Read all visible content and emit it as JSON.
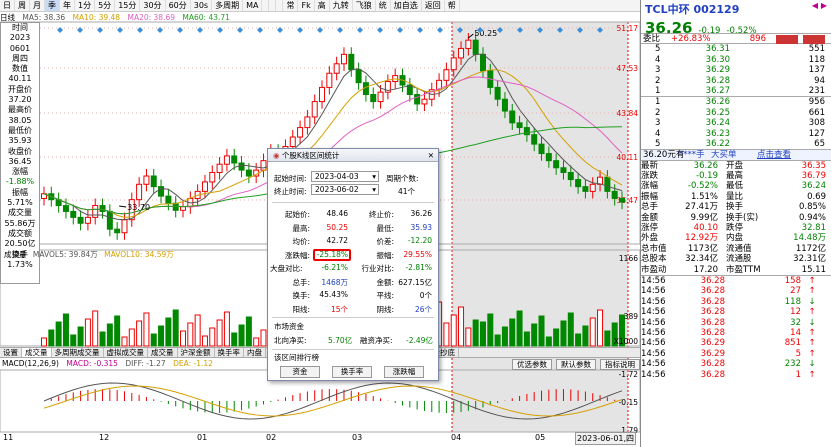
{
  "toolbar": {
    "items": [
      "日",
      "周",
      "月",
      "季",
      "年",
      "1分",
      "5分",
      "15分",
      "30分",
      "60分",
      "30s",
      "多周期",
      "MA",
      "",
      "",
      "",
      "常",
      "Fk",
      "高",
      "九转",
      "飞狼",
      "统",
      "加自选",
      "返回",
      "帮"
    ],
    "active": 3
  },
  "legend": {
    "name": "日线",
    "ma5": "MA5: 38.36",
    "ma10": "MA10: 39.48",
    "ma20": "MA20: 38.69",
    "ma60": "MA60: 43.71",
    "colors": {
      "ma5": "#555555",
      "ma10": "#d4a000",
      "ma20": "#e060c0",
      "ma60": "#20a020"
    }
  },
  "side_panel": [
    "时间",
    "2023",
    "0601",
    "周四",
    "数值",
    "40.11",
    "开盘价",
    "37.20",
    "最高价",
    "38.05",
    "最低价",
    "35.93",
    "收盘价",
    "36.45",
    "涨幅",
    "-1.88%",
    "振幅",
    "5.71%",
    "成交量",
    "55.86万",
    "成交额",
    "20.50亿",
    "换手",
    "1.73%"
  ],
  "price_axis": [
    "51.17",
    "47.53",
    "43.84",
    "40.11",
    "36.47"
  ],
  "chart_labels": {
    "high": "50.25",
    "low": "33.70"
  },
  "volume": {
    "legend": [
      "成交量",
      "MAVOL5: 39.84万",
      "MAVOL10: 34.59万"
    ],
    "axis": [
      "1166",
      "389",
      "X1000"
    ]
  },
  "bottom_tabs": [
    "设置",
    "成交量",
    "多周期成交量",
    "虚拟成交量",
    "成交量",
    "沪深金额",
    "换手率",
    "内盘",
    "胀跌通持续变化",
    "融资融券变化",
    "机构探测器",
    "资金抄底"
  ],
  "macd": {
    "legend": [
      "MACD(12,26,9)",
      "MACD: -0.315",
      "DIFF: -1.27",
      "DEA: -1.12"
    ],
    "axis": [
      "-1.72",
      "-0.15",
      "1.79"
    ],
    "subtabs": [
      "优选参数",
      "默认参数",
      "指标说明"
    ]
  },
  "x_axis": {
    "labels": [
      "11",
      "12",
      "01",
      "02",
      "03",
      "04",
      "05"
    ],
    "date": "2023-06-01,四"
  },
  "quote": {
    "name": "TCL中环",
    "code": "002129",
    "price": "36.26",
    "change": "-0.19",
    "pct": "-0.52%",
    "ratio_label": "委比",
    "ratio": "+26.83%",
    "diff": "896",
    "sell": "卖",
    "buy": "买",
    "asks": [
      [
        "5",
        "36.31",
        "551"
      ],
      [
        "4",
        "36.30",
        "118"
      ],
      [
        "3",
        "36.29",
        "137"
      ],
      [
        "2",
        "36.28",
        "94"
      ],
      [
        "1",
        "36.27",
        "231"
      ]
    ],
    "bids": [
      [
        "1",
        "36.26",
        "956"
      ],
      [
        "2",
        "36.25",
        "661"
      ],
      [
        "3",
        "36.24",
        "308"
      ],
      [
        "4",
        "36.23",
        "127"
      ],
      [
        "5",
        "36.22",
        "65"
      ]
    ],
    "banner": [
      "36.20元有",
      "****手",
      "大买单",
      "点击查看"
    ],
    "stats": [
      [
        "最新",
        "36.26",
        "开盘",
        "36.35"
      ],
      [
        "涨跌",
        "-0.19",
        "最高",
        "36.79"
      ],
      [
        "涨幅",
        "-0.52%",
        "最低",
        "36.24"
      ],
      [
        "振幅",
        "1.51%",
        "量比",
        "0.69"
      ],
      [
        "总手",
        "27.41万",
        "换手",
        "0.85%"
      ],
      [
        "金额",
        "9.99亿",
        "换手(实)",
        "0.94%"
      ],
      [
        "涨停",
        "40.10",
        "跌停",
        "32.81"
      ],
      [
        "外盘",
        "12.92万",
        "内盘",
        "14.48万"
      ],
      [
        "总市值",
        "1173亿",
        "流通值",
        "1172亿"
      ],
      [
        "总股本",
        "32.34亿",
        "流通股",
        "32.31亿"
      ],
      [
        "市盈动",
        "17.20",
        "市盈TTM",
        "15.11"
      ]
    ],
    "ticks": [
      [
        "14:56",
        "36.28",
        "158",
        "↑"
      ],
      [
        "14:56",
        "36.28",
        "27",
        "↑"
      ],
      [
        "14:56",
        "36.28",
        "118",
        "↓"
      ],
      [
        "14:56",
        "36.28",
        "12",
        "↑"
      ],
      [
        "14:56",
        "36.28",
        "32",
        "↓"
      ],
      [
        "14:56",
        "36.28",
        "14",
        "↑"
      ],
      [
        "14:56",
        "36.29",
        "851",
        "↑"
      ],
      [
        "14:56",
        "36.29",
        "5",
        "↑"
      ],
      [
        "14:56",
        "36.28",
        "232",
        "↓"
      ],
      [
        "14:56",
        "36.28",
        "1",
        "↑"
      ]
    ]
  },
  "dialog": {
    "title": "个股K线区间统计",
    "start_label": "起始时间:",
    "start_date": "2023-04-03",
    "end_label": "终止时间:",
    "end_date": "2023-06-02",
    "cycle_label": "周期个数:",
    "cycles": "41个",
    "stats": [
      [
        "起始价:",
        "48.46",
        "终止价:",
        "36.26"
      ],
      [
        "最高:",
        "50.25",
        "最低:",
        "35.93"
      ],
      [
        "均价:",
        "42.72",
        "价差:",
        "-12.20"
      ],
      [
        "涨跌幅:",
        "-25.18%",
        "振幅:",
        "29.55%"
      ],
      [
        "大盘对比:",
        "-6.21%",
        "行业对比:",
        "-2.81%"
      ],
      [
        "总手:",
        "1468万",
        "金额:",
        "627.15亿"
      ],
      [
        "换手:",
        "45.43%",
        "平线:",
        "0个"
      ],
      [
        "阳线:",
        "15个",
        "阴线:",
        "26个"
      ]
    ],
    "funds_title": "市场资金",
    "north_label": "北向净买:",
    "north": "5.70亿",
    "margin_label": "融资净买:",
    "margin": "-2.49亿",
    "rank_title": "该区间排行榜",
    "buttons": [
      "资金",
      "换手率",
      "涨跌幅"
    ]
  }
}
